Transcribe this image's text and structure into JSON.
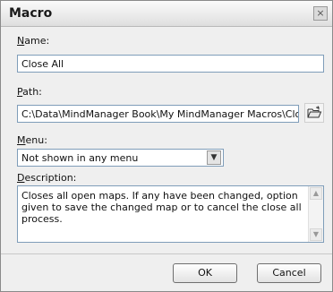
{
  "dialog": {
    "title": "Macro",
    "close_label": "×"
  },
  "name": {
    "label_acc": "N",
    "label_rest": "ame:",
    "value": "Close All"
  },
  "path": {
    "label_acc": "P",
    "label_rest": "ath:",
    "value": "C:\\Data\\MindManager Book\\My MindManager Macros\\Clo",
    "browse_icon": "folder-open-icon"
  },
  "menu": {
    "label_acc": "M",
    "label_rest": "enu:",
    "selected": "Not shown in any menu",
    "arrow": "▼"
  },
  "description": {
    "label_acc": "D",
    "label_rest": "escription:",
    "text": "Closes all open maps. If any have been changed, option given to save the changed map or to cancel the close all process."
  },
  "buttons": {
    "ok": "OK",
    "cancel": "Cancel"
  },
  "scroll_arrows": {
    "up": "▲",
    "down": "▼"
  }
}
